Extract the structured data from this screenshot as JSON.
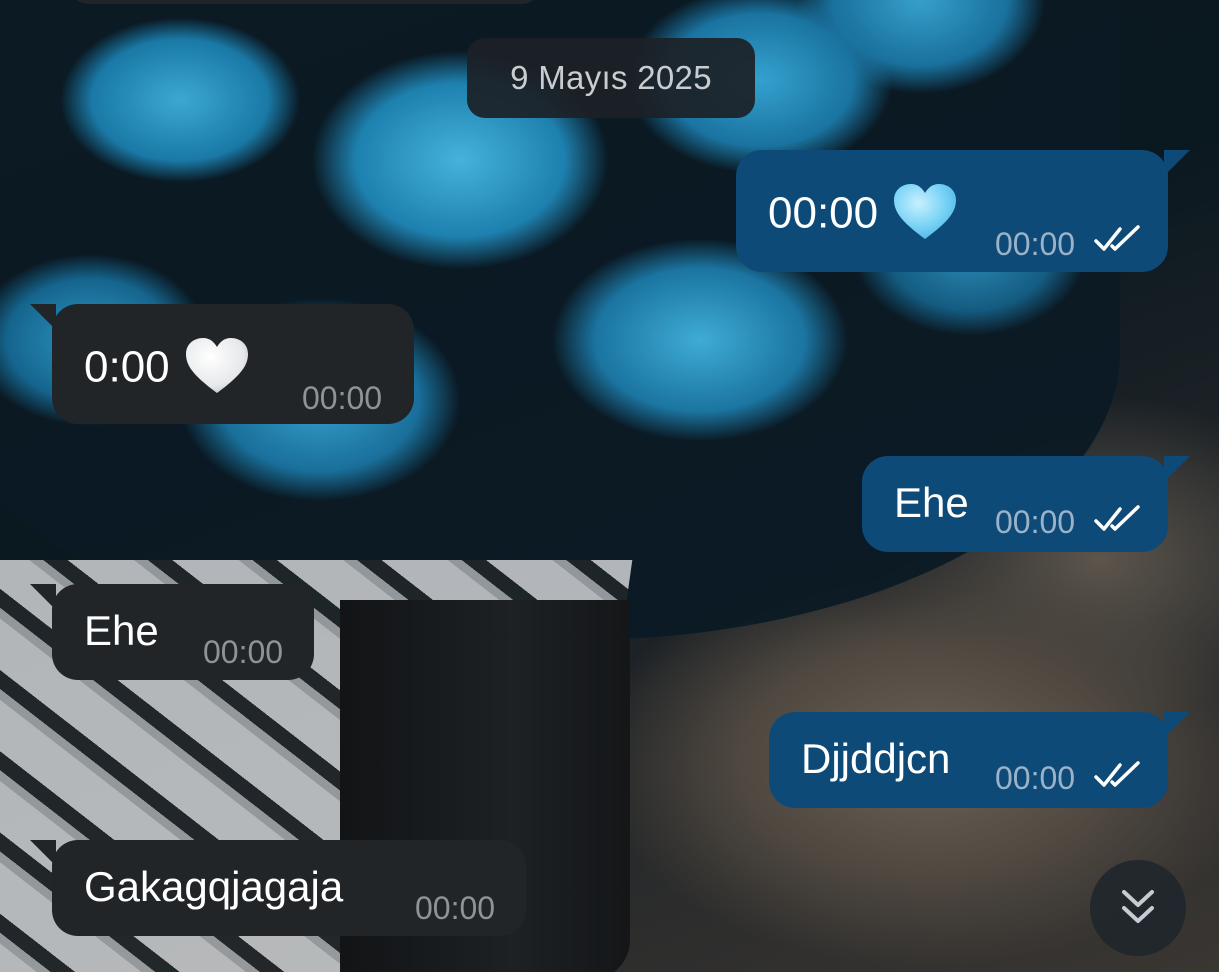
{
  "chat": {
    "date_chip": "9 Mayıs 2025",
    "messages": [
      {
        "dir": "out",
        "text": "00:00",
        "emoji": "light-blue-heart",
        "time": "00:00",
        "status": "read"
      },
      {
        "dir": "in",
        "text": "0:00",
        "emoji": "white-heart",
        "time": "00:00"
      },
      {
        "dir": "out",
        "text": "Ehe",
        "time": "00:00",
        "status": "read"
      },
      {
        "dir": "in",
        "text": "Ehe",
        "time": "00:00"
      },
      {
        "dir": "out",
        "text": "Djjddjcn",
        "time": "00:00",
        "status": "read"
      },
      {
        "dir": "in",
        "text": "Gakagqjagaja",
        "time": "00:00"
      }
    ]
  },
  "colors": {
    "outgoing_bubble": "#0e4a77",
    "incoming_bubble": "#212528",
    "read_ticks": "#ffffff",
    "timestamp_out": "#9ab3c8",
    "timestamp_in": "#8d9398"
  },
  "icons": {
    "read_receipt": "double-check-icon",
    "scroll_down": "double-chevron-down-icon"
  }
}
